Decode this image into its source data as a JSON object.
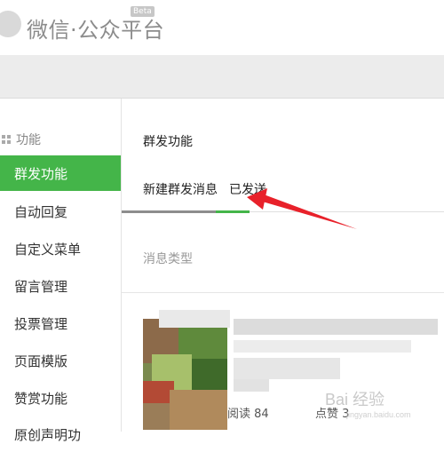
{
  "header": {
    "brand": "微信·公众平台",
    "badge": "Beta"
  },
  "sidebar": {
    "section_title": "功能",
    "items": [
      {
        "label": "群发功能",
        "active": true
      },
      {
        "label": "自动回复"
      },
      {
        "label": "自定义菜单"
      },
      {
        "label": "留言管理"
      },
      {
        "label": "投票管理"
      },
      {
        "label": "页面模版"
      },
      {
        "label": "赞赏功能"
      },
      {
        "label": "原创声明功"
      }
    ]
  },
  "main": {
    "title": "群发功能",
    "tabs": [
      {
        "label": "新建群发消息"
      },
      {
        "label": "已发送",
        "active": true
      }
    ],
    "filter_label": "消息类型",
    "message": {
      "read_text": "阅读 84",
      "like_text": "点赞 3"
    }
  },
  "watermark": {
    "text": "Bai 经验",
    "subtext": "jingyan.baidu.com"
  },
  "colors": {
    "accent": "#44b549",
    "arrow": "#e8212a"
  }
}
